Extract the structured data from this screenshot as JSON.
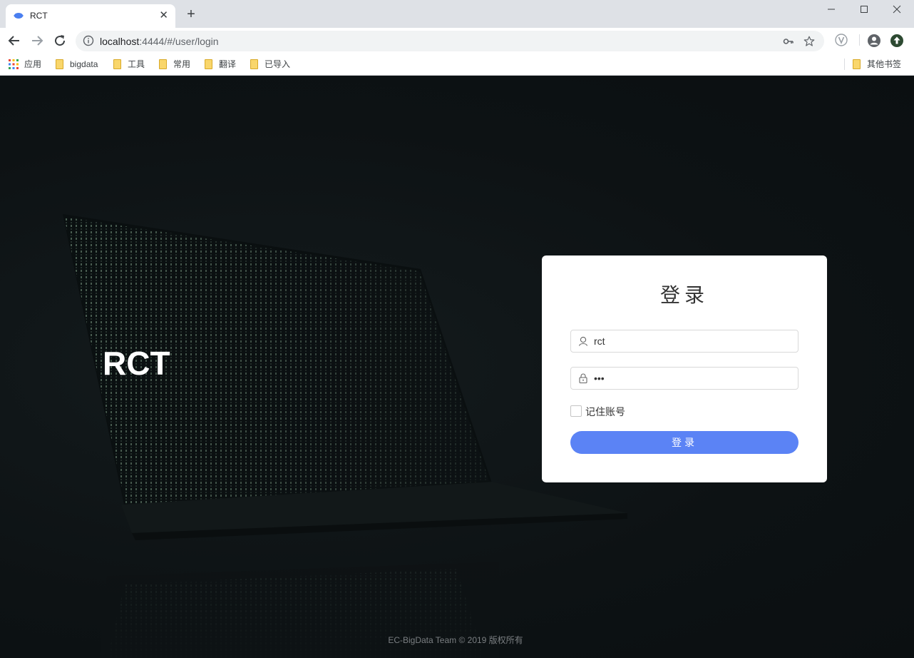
{
  "browser": {
    "tab_title": "RCT",
    "url_host": "localhost",
    "url_rest": ":4444/#/user/login",
    "bookmarks": [
      {
        "label": "应用",
        "icon": "apps-grid-icon"
      },
      {
        "label": "bigdata",
        "icon": "folder-icon"
      },
      {
        "label": "工具",
        "icon": "folder-icon"
      },
      {
        "label": "常用",
        "icon": "folder-icon"
      },
      {
        "label": "翻译",
        "icon": "folder-icon"
      },
      {
        "label": "已导入",
        "icon": "folder-icon"
      }
    ],
    "other_bookmarks": "其他书签"
  },
  "page": {
    "brand": "RCT",
    "login": {
      "title": "登录",
      "username_value": "rct",
      "password_value": "•••",
      "remember_label": "记住账号",
      "remember_checked": false,
      "submit_label": "登录"
    },
    "footer": "EC-BigData Team © 2019 版权所有"
  },
  "colors": {
    "accent": "#5b83f5",
    "background": "#0d1214",
    "code_green": "#8fb59a"
  }
}
